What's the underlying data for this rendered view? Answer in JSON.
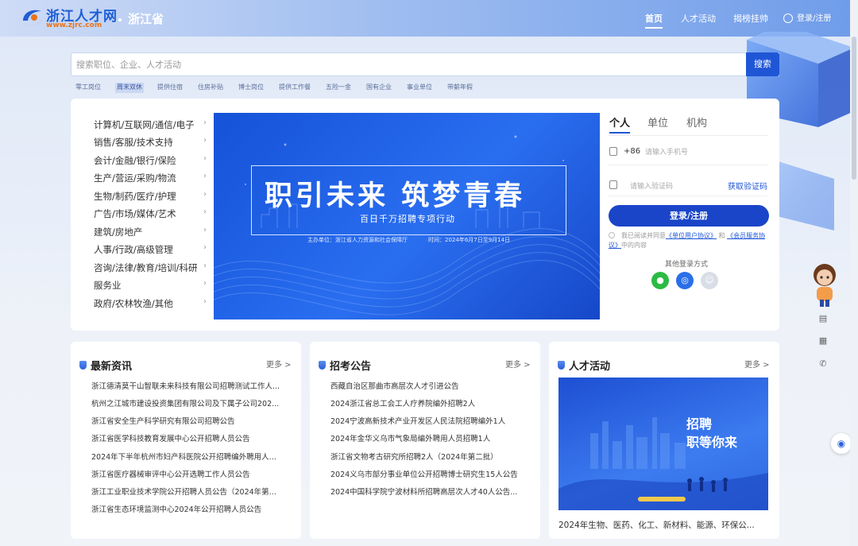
{
  "header": {
    "logo_text": "浙江人才网",
    "logo_url": "www.zjrc.com",
    "province": "浙江省",
    "nav": [
      "首页",
      "人才活动",
      "揭榜挂帅"
    ],
    "login_label": "登录/注册"
  },
  "search": {
    "placeholder": "搜索职位、企业、人才活动",
    "button_label": "搜索",
    "tags": [
      "零工岗位",
      "周末双休",
      "提供住宿",
      "住房补贴",
      "博士岗位",
      "提供工作餐",
      "五险一金",
      "国有企业",
      "事业单位",
      "带薪年假"
    ],
    "highlighted_tag": "周末双休"
  },
  "categories": [
    "计算机/互联网/通信/电子",
    "销售/客服/技术支持",
    "会计/金融/银行/保险",
    "生产/营运/采购/物流",
    "生物/制药/医疗/护理",
    "广告/市场/媒体/艺术",
    "建筑/房地产",
    "人事/行政/高级管理",
    "咨询/法律/教育/培训/科研",
    "服务业",
    "政府/农林牧渔/其他"
  ],
  "banner": {
    "title": "职引未来  筑梦青春",
    "subtitle": "百日千万招聘专项行动",
    "organizer": "主办单位：浙江省人力资源和社会保障厅",
    "dates": "时间：2024年6月7日至9月14日",
    "slide_count": 4,
    "active_slide": 3
  },
  "login_panel": {
    "tabs": [
      "个人",
      "单位",
      "机构"
    ],
    "active_tab": "个人",
    "phone_prefix": "+86",
    "phone_placeholder": "请输入手机号",
    "code_placeholder": "请输入验证码",
    "get_code_label": "获取验证码",
    "submit_label": "登录/注册",
    "agreement_prefix": "我已阅读并同意",
    "agreement_link1": "《单位用户协议》",
    "agreement_and": "和",
    "agreement_link2": "《会员服务协议》",
    "agreement_suffix": "中的内容",
    "other_login_label": "其他登录方式",
    "other_login_icons": [
      "wechat-icon",
      "scan-icon",
      "face-icon"
    ]
  },
  "news": {
    "title": "最新资讯",
    "more_label": "更多 >",
    "items": [
      "浙江德清莫干山智联未来科技有限公司招聘测试工作人...",
      "杭州之江城市建设投资集团有限公司及下属子公司202...",
      "浙江省安全生产科学研究有限公司招聘公告",
      "浙江省医学科技教育发展中心公开招聘人员公告",
      "2024年下半年杭州市妇产科医院公开招聘编外聘用人...",
      "浙江省医疗器械审评中心公开选聘工作人员公告",
      "浙江工业职业技术学院公开招聘人员公告（2024年第...",
      "浙江省生态环境监测中心2024年公开招聘人员公告"
    ]
  },
  "exams": {
    "title": "招考公告",
    "more_label": "更多 >",
    "items": [
      "西藏自治区那曲市高层次人才引进公告",
      "2024浙江省总工会工人疗养院编外招聘2人",
      "2024宁波高新技术产业开发区人民法院招聘编外1人",
      "2024年金华义乌市气象局编外聘用人员招聘1人",
      "浙江省文物考古研究所招聘2人（2024年第二批）",
      "2024义乌市部分事业单位公开招聘博士研究生15人公告",
      "2024中国科学院宁波材料所招聘高层次人才40人公告..."
    ]
  },
  "activities": {
    "title": "人才活动",
    "more_label": "更多 >",
    "image_line1": "招聘",
    "image_line2": "职等你来",
    "caption": "2024年生物、医药、化工、新材料、能源、环保公..."
  },
  "sidebar_tools": [
    "doc-icon",
    "list-icon",
    "phone-icon"
  ]
}
